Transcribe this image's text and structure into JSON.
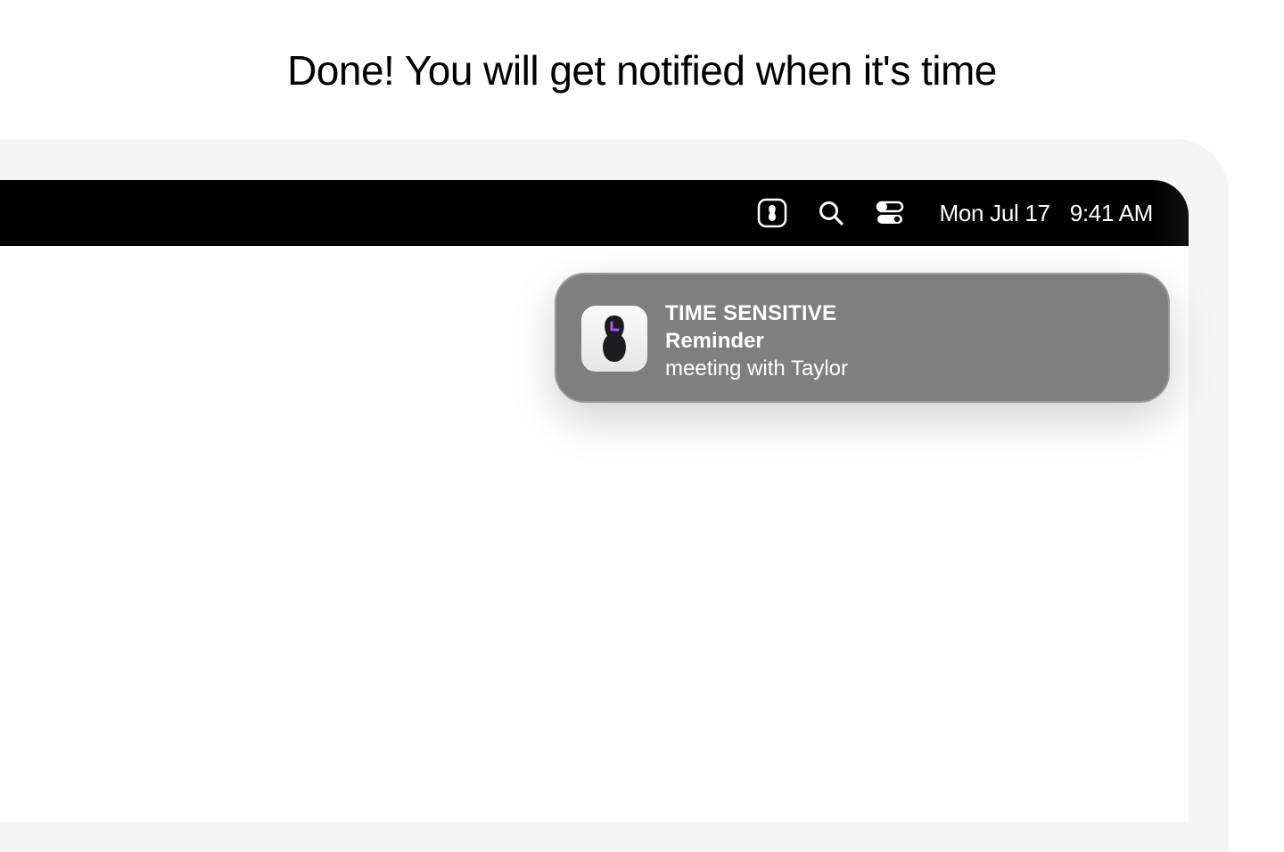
{
  "headline": "Done! You will get notified when it's time",
  "menubar": {
    "icons": [
      "app-status-icon",
      "search-icon",
      "control-center-icon"
    ],
    "date": "Mon Jul 17",
    "time": "9:41 AM"
  },
  "notification": {
    "app_icon": "reminder-app-icon",
    "category": "TIME SENSITIVE",
    "title": "Reminder",
    "body": "meeting with Taylor"
  },
  "colors": {
    "menubar_bg": "#000000",
    "notification_bg": "#7f7f7f",
    "accent": "#a855f7"
  }
}
